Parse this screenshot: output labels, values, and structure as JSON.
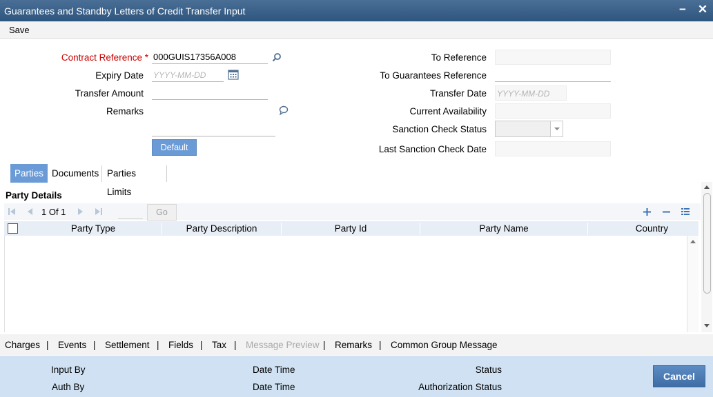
{
  "window": {
    "title": "Guarantees and Standby Letters of Credit Transfer Input",
    "minimize": "−",
    "close": "✕"
  },
  "menu": {
    "save": "Save"
  },
  "form": {
    "contract_reference": {
      "label": "Contract Reference",
      "required_mark": "*",
      "value": "000GUIS17356A008"
    },
    "expiry_date": {
      "label": "Expiry Date",
      "placeholder": "YYYY-MM-DD"
    },
    "transfer_amount": {
      "label": "Transfer Amount"
    },
    "remarks": {
      "label": "Remarks"
    },
    "default_button": "Default",
    "to_reference": {
      "label": "To Reference"
    },
    "to_guarantees_reference": {
      "label": "To Guarantees Reference"
    },
    "transfer_date": {
      "label": "Transfer Date",
      "placeholder": "YYYY-MM-DD"
    },
    "current_availability": {
      "label": "Current Availability"
    },
    "sanction_check_status": {
      "label": "Sanction Check Status"
    },
    "last_sanction_check_date": {
      "label": "Last Sanction Check Date"
    }
  },
  "tabs": [
    {
      "label": "Parties",
      "active": true
    },
    {
      "label": "Documents"
    },
    {
      "label": "Parties Limits"
    }
  ],
  "party_details": {
    "title": "Party Details",
    "pager": {
      "text": "1 Of 1",
      "go": "Go"
    },
    "columns": [
      "Party Type",
      "Party Description",
      "Party Id",
      "Party Name",
      "Country"
    ],
    "rows": []
  },
  "links": [
    "Charges",
    "Events",
    "Settlement",
    "Fields",
    "Tax",
    "Message Preview",
    "Remarks",
    "Common Group Message"
  ],
  "link_separator": "|",
  "footer": {
    "input_by": "Input By",
    "auth_by": "Auth By",
    "date_time_1": "Date Time",
    "date_time_2": "Date Time",
    "status": "Status",
    "authorization_status": "Authorization Status",
    "cancel": "Cancel"
  },
  "colors": {
    "accent": "#6b9bd6",
    "titlebar": "#2e557e",
    "footer": "#cfe1f2",
    "required": "#cc0000"
  },
  "icons": [
    "search-icon",
    "calendar-icon",
    "comment-icon",
    "first-page-icon",
    "prev-page-icon",
    "next-page-icon",
    "last-page-icon",
    "add-row-icon",
    "delete-row-icon",
    "single-view-icon"
  ]
}
